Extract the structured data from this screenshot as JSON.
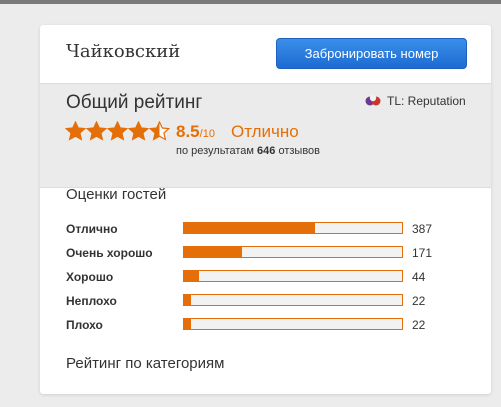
{
  "hotel": {
    "name": "Чайковский",
    "book_label": "Забронировать номер"
  },
  "overall": {
    "title": "Общий рейтинг",
    "provider": "TL: Reputation",
    "provider_icon": "tl-reputation-logo-icon",
    "stars": 4.5,
    "stars_max": 5,
    "score": "8.5",
    "score_denom": "/10",
    "score_word": "Отлично",
    "reviews_prefix": "по результатам",
    "reviews_count": "646",
    "reviews_suffix": "отзывов"
  },
  "guest_ratings": {
    "title": "Оценки гостей",
    "max": 646,
    "rows": [
      {
        "label": "Отлично",
        "count": "387",
        "value": 387
      },
      {
        "label": "Очень хорошо",
        "count": "171",
        "value": 171
      },
      {
        "label": "Хорошо",
        "count": "44",
        "value": 44
      },
      {
        "label": "Неплохо",
        "count": "22",
        "value": 22
      },
      {
        "label": "Плохо",
        "count": "22",
        "value": 22
      }
    ]
  },
  "categories": {
    "title": "Рейтинг по категориям"
  },
  "colors": {
    "accent": "#e46f08",
    "button": "#1d6bd3"
  }
}
